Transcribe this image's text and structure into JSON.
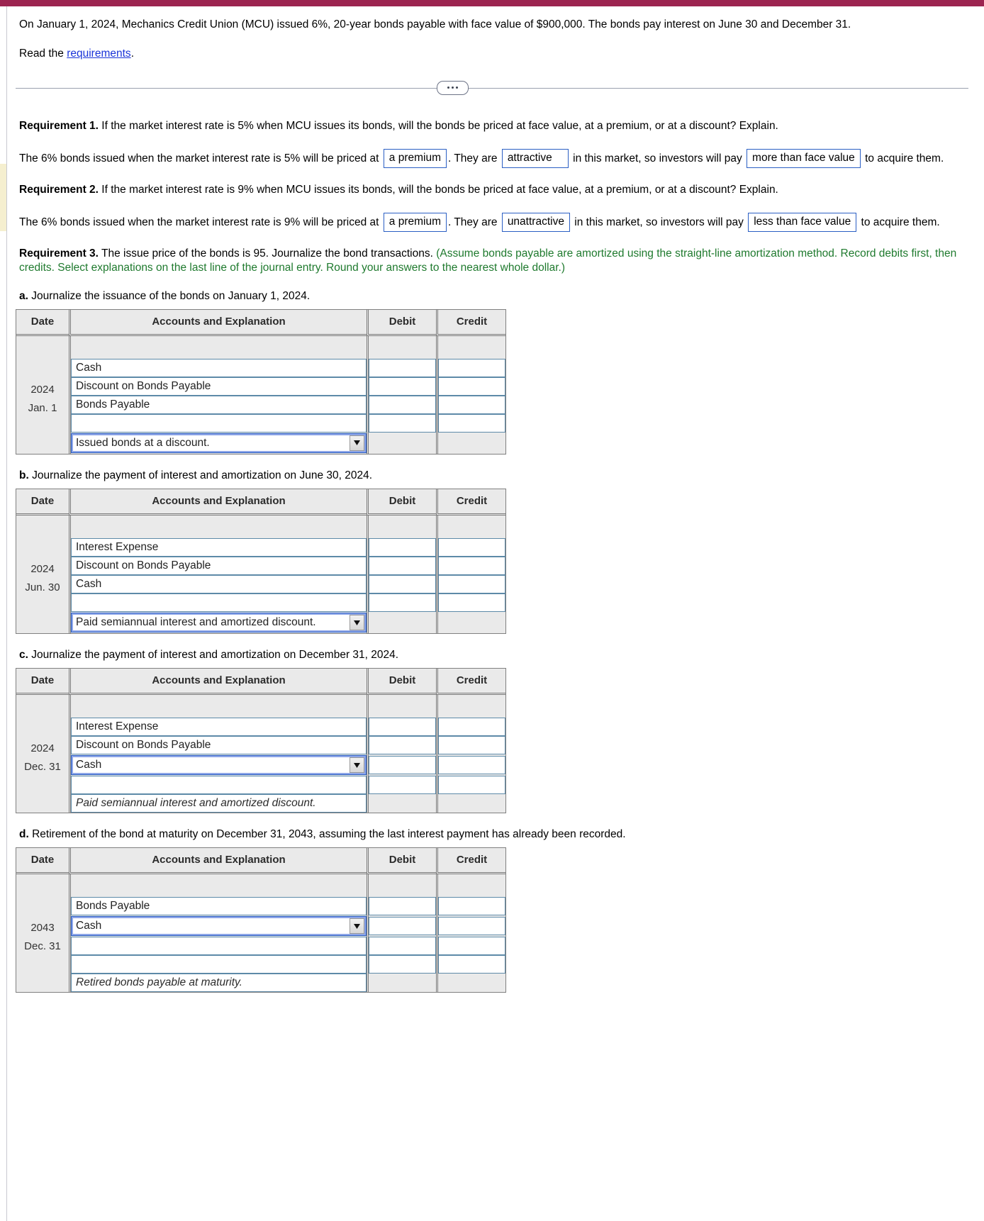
{
  "theme": {
    "accent": "#9c2450",
    "link": "#1a34d8",
    "green": "#1f7a2e",
    "field_border": "#2b5fc4"
  },
  "intro": {
    "problem": "On January 1, 2024, Mechanics Credit Union (MCU) issued 6%, 20-year bonds payable with face value of $900,000. The bonds pay interest on June 30 and December 31.",
    "read_prefix": "Read the ",
    "read_link": "requirements",
    "read_suffix": "."
  },
  "divider": {
    "ellipsis": "…"
  },
  "requirement1": {
    "label": "Requirement 1.",
    "text": " If the market interest rate is 5% when MCU issues its bonds, will the bonds be priced at face value, at a premium, or at a discount? Explain.",
    "answer": {
      "part1": "The 6% bonds issued when the market interest rate is 5% will be priced at",
      "field_price": "a premium",
      "part2": ". They are",
      "field_attract": "attractive",
      "part3": "in this market, so investors will pay",
      "field_pay": "more than face value",
      "part4": "to acquire them."
    }
  },
  "requirement2": {
    "label": "Requirement 2.",
    "text": " If the market interest rate is 9% when MCU issues its bonds, will the bonds be priced at face value, at a premium, or at a discount? Explain.",
    "answer": {
      "part1": "The 6% bonds issued when the market interest rate is 9% will be priced at",
      "field_price": "a premium",
      "part2": ". They are",
      "field_attract": "unattractive",
      "part3": "in this market, so investors will pay",
      "field_pay": "less than face value",
      "part4": "to acquire them."
    }
  },
  "requirement3": {
    "label": "Requirement 3.",
    "text": " The issue price of the bonds is 95. Journalize the bond transactions. ",
    "note": "(Assume bonds payable are amortized using the straight-line amortization method. Record debits first, then credits. Select explanations on the last line of the journal entry. Round your answers to the nearest whole dollar.)"
  },
  "columns": {
    "date": "Date",
    "accounts": "Accounts and Explanation",
    "debit": "Debit",
    "credit": "Credit"
  },
  "parts": {
    "a": {
      "letter": "a.",
      "prompt": " Journalize the issuance of the bonds on January 1, 2024.",
      "year": "2024",
      "day": "Jan. 1",
      "rows": [
        {
          "account": "Cash",
          "debit": "",
          "credit": "",
          "type": "input"
        },
        {
          "account": "Discount on Bonds Payable",
          "debit": "",
          "credit": "",
          "type": "input"
        },
        {
          "account": "Bonds Payable",
          "debit": "",
          "credit": "",
          "type": "input"
        },
        {
          "account": "",
          "debit": "",
          "credit": "",
          "type": "input"
        }
      ],
      "explanation": {
        "text": "Issued bonds at a discount.",
        "type": "select"
      }
    },
    "b": {
      "letter": "b.",
      "prompt": " Journalize the payment of interest and amortization on June 30, 2024.",
      "year": "2024",
      "day": "Jun. 30",
      "rows": [
        {
          "account": "Interest Expense",
          "debit": "",
          "credit": "",
          "type": "input"
        },
        {
          "account": "Discount on Bonds Payable",
          "debit": "",
          "credit": "",
          "type": "input"
        },
        {
          "account": "Cash",
          "debit": "",
          "credit": "",
          "type": "input"
        },
        {
          "account": "",
          "debit": "",
          "credit": "",
          "type": "input"
        }
      ],
      "explanation": {
        "text": "Paid semiannual interest and amortized discount.",
        "type": "select"
      }
    },
    "c": {
      "letter": "c.",
      "prompt": " Journalize the payment of interest and amortization on December 31, 2024.",
      "year": "2024",
      "day": "Dec. 31",
      "rows": [
        {
          "account": "Interest Expense",
          "debit": "",
          "credit": "",
          "type": "input"
        },
        {
          "account": "Discount on Bonds Payable",
          "debit": "",
          "credit": "",
          "type": "input"
        },
        {
          "account": "Cash",
          "debit": "",
          "credit": "",
          "type": "select"
        },
        {
          "account": "",
          "debit": "",
          "credit": "",
          "type": "input"
        }
      ],
      "explanation": {
        "text": "Paid semiannual interest and amortized discount.",
        "type": "italic"
      }
    },
    "d": {
      "letter": "d.",
      "prompt": " Retirement of the bond at maturity on December 31, 2043, assuming the last interest payment has already been recorded.",
      "year": "2043",
      "day": "Dec. 31",
      "rows": [
        {
          "account": "Bonds Payable",
          "debit": "",
          "credit": "",
          "type": "input"
        },
        {
          "account": "Cash",
          "debit": "",
          "credit": "",
          "type": "select"
        },
        {
          "account": "",
          "debit": "",
          "credit": "",
          "type": "input"
        },
        {
          "account": "",
          "debit": "",
          "credit": "",
          "type": "input"
        }
      ],
      "explanation": {
        "text": "Retired bonds payable at maturity.",
        "type": "italic"
      }
    }
  }
}
